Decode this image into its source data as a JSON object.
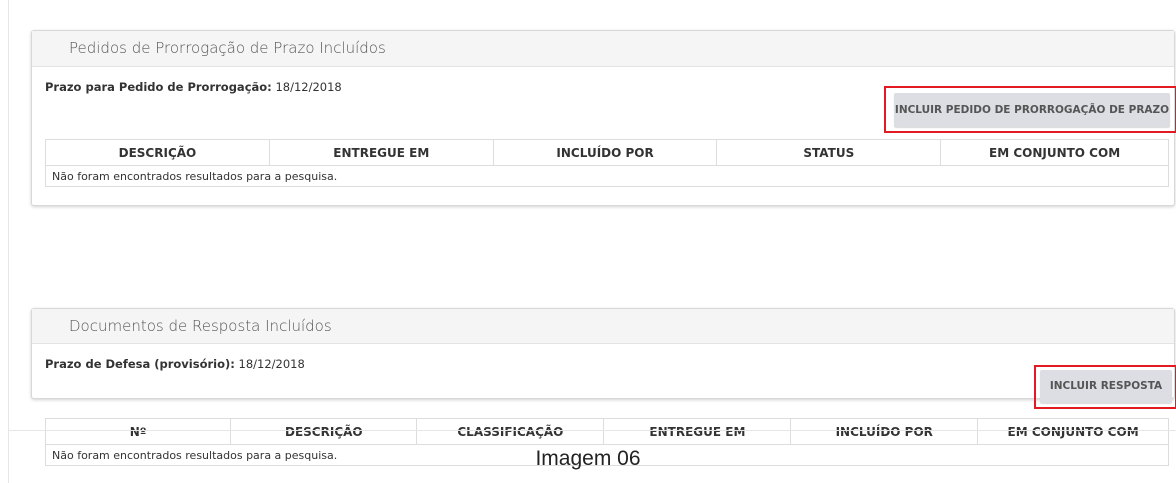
{
  "extensions_panel": {
    "title": "Pedidos de Prorrogação de Prazo Incluídos",
    "deadline_label": "Prazo para Pedido de Prorrogação:",
    "deadline_value": "18/12/2018",
    "add_button_label": "INCLUIR PEDIDO DE PRORROGAÇÃO DE PRAZO",
    "columns": [
      "DESCRIÇÃO",
      "ENTREGUE EM",
      "INCLUÍDO POR",
      "STATUS",
      "EM CONJUNTO COM"
    ],
    "empty_message": "Não foram encontrados resultados para a pesquisa."
  },
  "responses_panel": {
    "title": "Documentos de Resposta Incluídos",
    "deadline_label": "Prazo de Defesa (provisório):",
    "deadline_value": "18/12/2018",
    "add_button_label": "INCLUIR RESPOSTA",
    "columns": [
      "Nº",
      "DESCRIÇÃO",
      "CLASSIFICAÇÃO",
      "ENTREGUE EM",
      "INCLUÍDO POR",
      "EM CONJUNTO COM"
    ],
    "empty_message": "Não foram encontrados resultados para a pesquisa."
  },
  "caption": "Imagem 06",
  "colors": {
    "highlight_border": "#e21a22",
    "button_bg": "#dcdee3",
    "panel_heading_bg": "#f5f5f5"
  }
}
